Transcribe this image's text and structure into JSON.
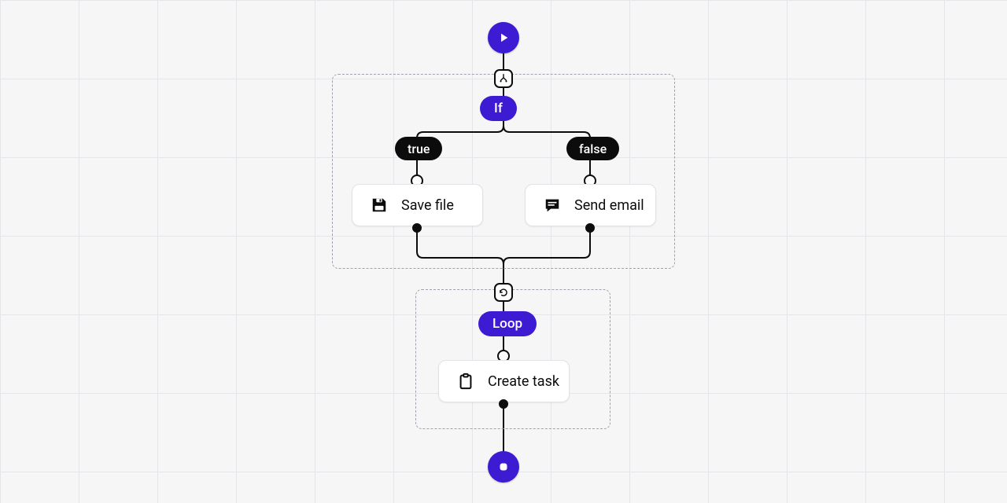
{
  "flow": {
    "if": {
      "label": "If",
      "true_label": "true",
      "false_label": "false"
    },
    "loop": {
      "label": "Loop"
    },
    "nodes": {
      "save_file": {
        "label": "Save file"
      },
      "send_email": {
        "label": "Send email"
      },
      "create_task": {
        "label": "Create task"
      }
    }
  }
}
